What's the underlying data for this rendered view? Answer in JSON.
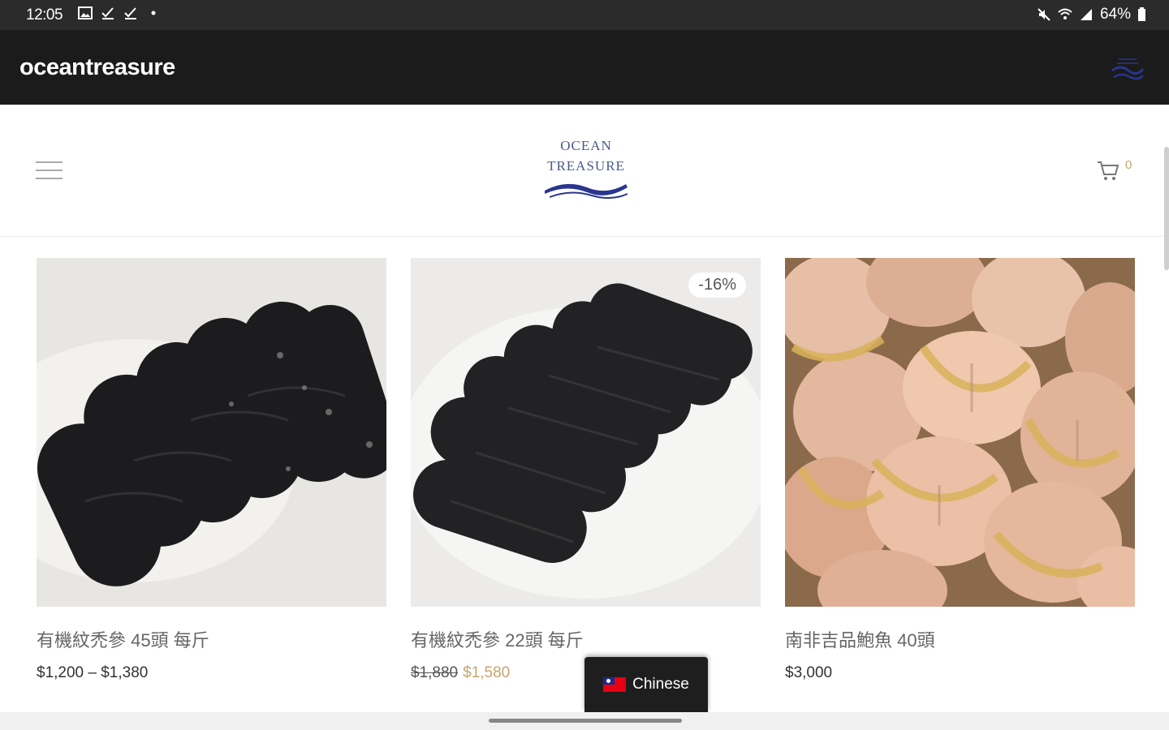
{
  "status_bar": {
    "time": "12:05",
    "battery": "64%",
    "left_icons": [
      "image-icon",
      "check-icon",
      "check-icon",
      "dot-icon"
    ],
    "right_icons": [
      "mute-icon",
      "wifi-icon",
      "signal-icon",
      "battery-icon"
    ]
  },
  "app_bar": {
    "title": "oceantreasure"
  },
  "header": {
    "logo_line1": "OCEAN",
    "logo_line2": "TREASURE",
    "cart_count": "0",
    "brand_color": "#2a3590"
  },
  "products": [
    {
      "name": "有機紋禿參 45頭 每斤",
      "price": "$1,200 – $1,380"
    },
    {
      "name": "有機紋禿參 22頭 每斤",
      "old_price": "$1,880",
      "sale_price": "$1,580",
      "badge": "-16%"
    },
    {
      "name": "南非吉品鮑魚 40頭",
      "price": "$3,000"
    }
  ],
  "language_button": {
    "label": "Chinese"
  }
}
